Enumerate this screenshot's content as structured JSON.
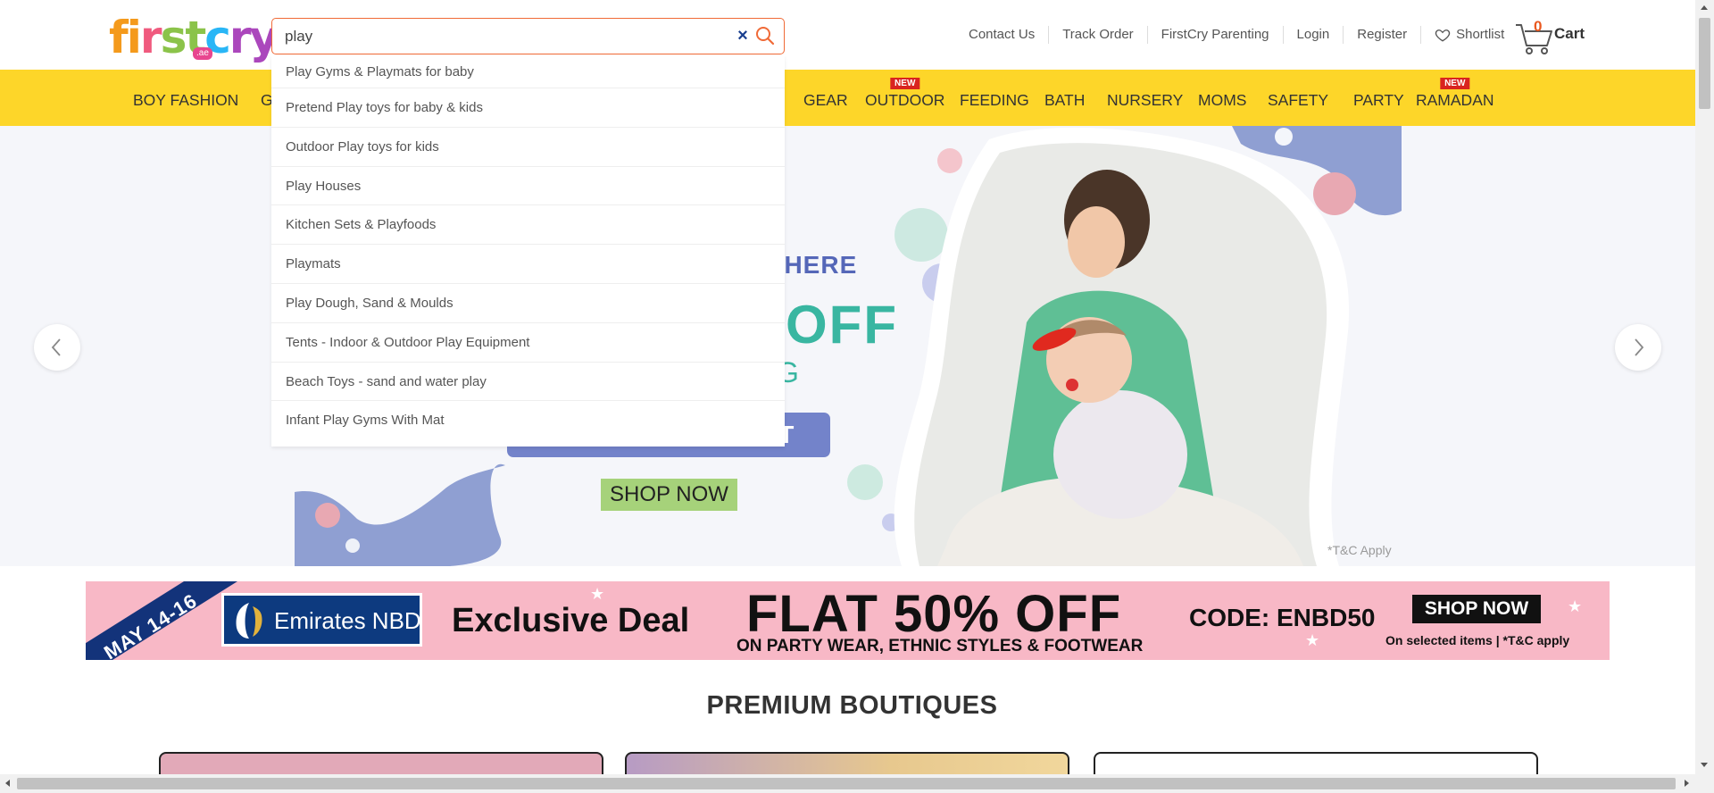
{
  "header": {
    "logo_text": "firstcry",
    "logo_tld": ".ae",
    "search": {
      "value": "play",
      "placeholder": ""
    },
    "top_links": {
      "contact": "Contact Us",
      "track": "Track Order",
      "parenting": "FirstCry Parenting",
      "login": "Login",
      "register": "Register",
      "shortlist": "Shortlist"
    },
    "cart": {
      "count": "0",
      "label": "Cart"
    }
  },
  "navbar": {
    "items": [
      {
        "label": "BOY FASHION",
        "badge": ""
      },
      {
        "label": "G",
        "badge": ""
      },
      {
        "label": "GEAR",
        "badge": ""
      },
      {
        "label": "OUTDOOR",
        "badge": "NEW"
      },
      {
        "label": "FEEDING",
        "badge": ""
      },
      {
        "label": "BATH",
        "badge": ""
      },
      {
        "label": "NURSERY",
        "badge": ""
      },
      {
        "label": "MOMS",
        "badge": ""
      },
      {
        "label": "SAFETY",
        "badge": ""
      },
      {
        "label": "PARTY",
        "badge": ""
      },
      {
        "label": "RAMADAN",
        "badge": "NEW"
      }
    ]
  },
  "suggestions": [
    "Play Gyms & Playmats for baby",
    "Pretend Play toys for baby & kids",
    "Outdoor Play toys for kids",
    "Play Houses",
    "Kitchen Sets & Playfoods",
    "Playmats",
    "Play Dough, Sand & Moulds",
    "Tents - Indoor & Outdoor Play Equipment",
    "Beach Toys - sand and water play",
    "Infant Play Gyms With Mat"
  ],
  "hero": {
    "headline_partial": "S HERE",
    "off_partial": "OFF",
    "sub_partial": "G",
    "pill_partial": "HT",
    "shop_now": "SHOP NOW",
    "tnc": "*T&C Apply"
  },
  "promo": {
    "date": "MAY 14-16",
    "bank": "Emirates NBD",
    "exclusive": "Exclusive Deal",
    "flat": "FLAT 50% OFF",
    "sub": "ON PARTY WEAR, ETHNIC STYLES & FOOTWEAR",
    "code": "CODE: ENBD50",
    "shop": "SHOP NOW",
    "note": "On selected items | *T&C apply"
  },
  "boutiques": {
    "title": "PREMIUM BOUTIQUES"
  },
  "colors": {
    "accent_orange": "#f06a37",
    "navbar_yellow": "#fdd629",
    "badge_red": "#d9241f",
    "promo_pink": "#f8b8c6",
    "clear_icon_blue": "#1a3f8f"
  }
}
